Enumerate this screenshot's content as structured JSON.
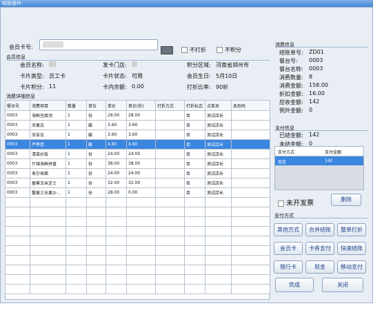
{
  "window": {
    "title": "结账操作"
  },
  "member": {
    "card_label": "会员卡号:",
    "card_value": "",
    "no_discount_label": "不打折",
    "no_points_label": "不积分",
    "section_title": "会员信息",
    "fields": [
      {
        "label": "会员名称:",
        "value": ""
      },
      {
        "label": "发卡门店:",
        "value": ""
      },
      {
        "label": "积分区域:",
        "value": "河南省郑州市"
      },
      {
        "label": "卡片类型:",
        "value": "员工卡"
      },
      {
        "label": "卡片状态:",
        "value": "可用"
      },
      {
        "label": "会员生日:",
        "value": "5月10日"
      },
      {
        "label": "卡片积分:",
        "value": "11"
      },
      {
        "label": "卡内余额:",
        "value": "0.00"
      },
      {
        "label": "打折比率:",
        "value": "90折"
      }
    ]
  },
  "detail": {
    "section_title": "消费详细信息",
    "columns": [
      "餐台号",
      "消费项目",
      "数量",
      "单位",
      "单价",
      "单价(折)",
      "打折方式",
      "打折标志",
      "点菜员",
      "条形码"
    ],
    "rows": [
      [
        "0003",
        "海鲜豆腐汤",
        "1",
        "份",
        "28.00",
        "28.00",
        "",
        "否",
        "测试店长",
        ""
      ],
      [
        "0003",
        "凉黄瓜",
        "1",
        "碟",
        "3.60",
        "3.60",
        "",
        "否",
        "测试店长",
        ""
      ],
      [
        "0003",
        "凉苦瓜",
        "1",
        "碟",
        "3.60",
        "3.60",
        "",
        "否",
        "测试店长",
        ""
      ],
      [
        "0003",
        "芦笋卷",
        "1",
        "碟",
        "4.80",
        "4.80",
        "",
        "否",
        "测试店长",
        ""
      ],
      [
        "0003",
        "清菜炒饭",
        "1",
        "份",
        "24.00",
        "24.00",
        "",
        "否",
        "测试店长",
        ""
      ],
      [
        "0003",
        "什锦海鲜拼盘",
        "1",
        "份",
        "38.00",
        "38.00",
        "",
        "否",
        "测试店长",
        ""
      ],
      [
        "0003",
        "寿尔寿面",
        "1",
        "份",
        "24.00",
        "24.00",
        "",
        "否",
        "测试店长",
        ""
      ],
      [
        "0003",
        "香蕉玉米芝士",
        "1",
        "份",
        "32.00",
        "32.00",
        "",
        "否",
        "测试店长",
        ""
      ],
      [
        "0003",
        "蟹黄土水果沙...",
        "1",
        "份",
        "28.00",
        "0.00",
        "",
        "否",
        "测试店长",
        ""
      ]
    ],
    "selected_row": 3
  },
  "consume": {
    "section_title": "消费信息",
    "fields": [
      {
        "label": "结账单号:",
        "value": "ZD01"
      },
      {
        "label": "餐台号:",
        "value": "0003"
      },
      {
        "label": "餐台名称:",
        "value": "0003"
      },
      {
        "label": "消费数量:",
        "value": "8"
      },
      {
        "label": "消费金额:",
        "value": "158.00"
      },
      {
        "label": "折扣金额:",
        "value": "16.00"
      },
      {
        "label": "应收金额:",
        "value": "142"
      },
      {
        "label": "例外金额:",
        "value": "0"
      }
    ]
  },
  "payinfo": {
    "section_title": "支付信息",
    "paid_label": "已结金额:",
    "paid_value": "142",
    "unpaid_label": "未结金额:",
    "unpaid_value": "0",
    "table_headers": [
      "支付方式",
      "支付金额"
    ],
    "table_rows": [
      [
        "现金",
        "142"
      ]
    ]
  },
  "invoice": {
    "label": "未开发票"
  },
  "delete_button": "删除",
  "paymethods": {
    "section_title": "支付方式",
    "buttons": [
      "其他方式",
      "合并结账",
      "整单打折",
      "会员卡",
      "卡券支付",
      "快速结账",
      "银行卡",
      "现金",
      "移动支付"
    ]
  },
  "actions": {
    "finish": "完成",
    "close": "关闭"
  }
}
